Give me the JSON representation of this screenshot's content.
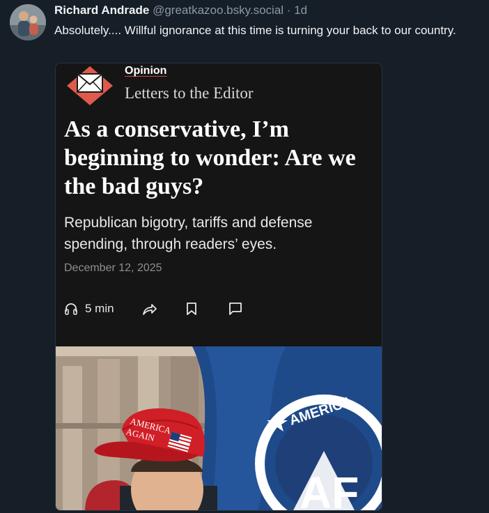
{
  "post": {
    "author_name": "Richard Andrade",
    "handle": "@greatkazoo.bsky.social",
    "separator": "·",
    "time": "1d",
    "text": "Absolutely.... Willful ignorance at this time is turning your back to our country."
  },
  "card": {
    "section": "Opinion",
    "subsection": "Letters to the Editor",
    "headline": "As a conservative, I’m beginning to wonder: Are we the bad guys?",
    "dek": "Republican bigotry, tariffs and defense spending, through readers’ eyes.",
    "date": "December 12, 2025",
    "listen_label": "5 min",
    "icons": [
      "envelope-icon",
      "headphones-icon",
      "share-icon",
      "bookmark-icon",
      "comment-icon"
    ],
    "accent_color": "#e05a4c",
    "photo": {
      "cap_text_line1": "AMERICA",
      "cap_text_line2": "AGAIN",
      "flag_text": "AMERICA",
      "flag_logo": "AF"
    }
  },
  "colors": {
    "background": "#161e27",
    "card_background": "#151515",
    "handle_gray": "#8c98a6"
  }
}
